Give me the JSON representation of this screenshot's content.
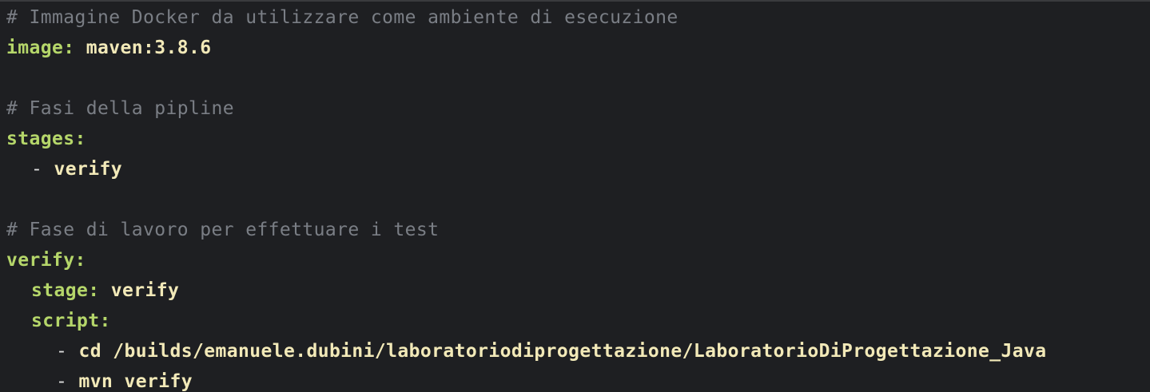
{
  "lines": {
    "comment_image": "# Immagine Docker da utilizzare come ambiente di esecuzione",
    "image_key": "image:",
    "image_value": " maven:3.8.6",
    "comment_stages": "# Fasi della pipline",
    "stages_key": "stages:",
    "stage_item_dash": "- ",
    "stage_item_value": "verify",
    "comment_job": "# Fase di lavoro per effettuare i test",
    "job_key": "verify:",
    "stage_key": "stage:",
    "stage_value": " verify",
    "script_key": "script:",
    "script_cmd1_dash": "- ",
    "script_cmd1": "cd /builds/emanuele.dubini/laboratoriodiprogettazione/LaboratorioDiProgettazione_Java",
    "script_cmd2_dash": "- ",
    "script_cmd2": "mvn verify"
  },
  "colors": {
    "background": "#1e1f22",
    "comment": "#7a7e85",
    "key": "#b5d66a",
    "value": "#f2e9b8"
  }
}
